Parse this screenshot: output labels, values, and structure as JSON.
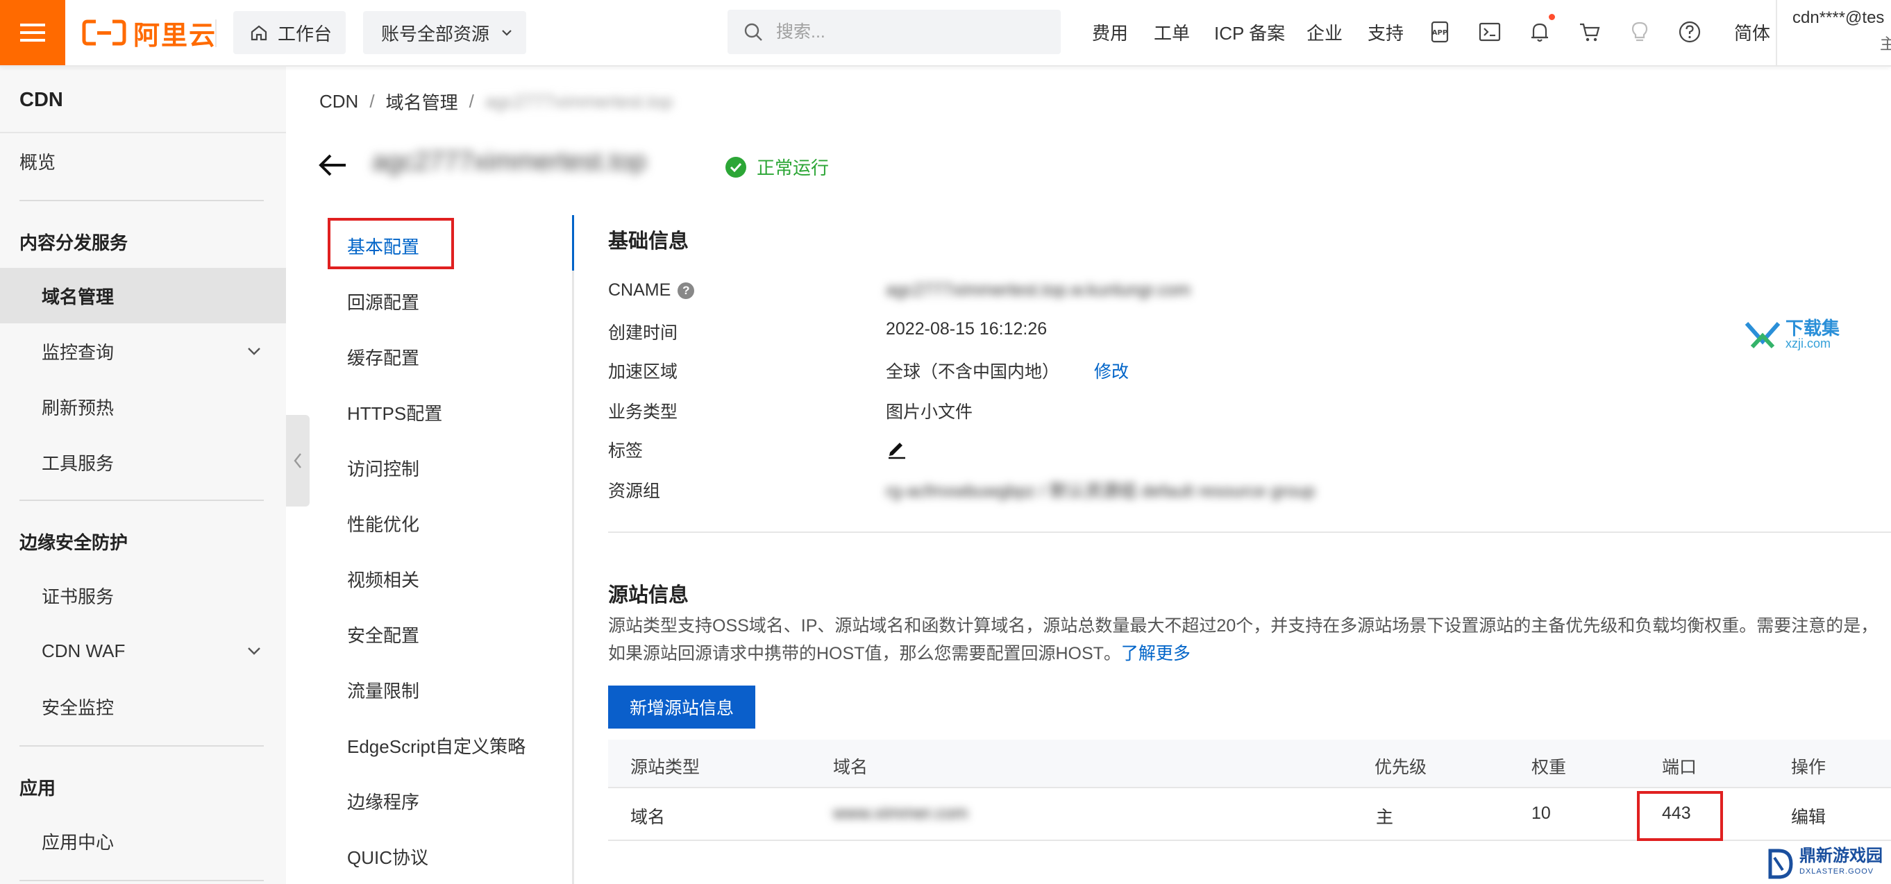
{
  "brand": {
    "logo_text": "阿里云",
    "accent": "#ff6a00"
  },
  "topbar": {
    "workbench": "工作台",
    "resource_scope": "账号全部资源",
    "search_placeholder": "搜索...",
    "nav": [
      "费用",
      "工单",
      "ICP 备案",
      "企业",
      "支持"
    ],
    "lang": "简体",
    "account": "cdn****@tes",
    "account_sub": "主"
  },
  "sidebar": {
    "title": "CDN",
    "overview": "概览",
    "group1": {
      "title": "内容分发服务",
      "items": [
        "域名管理",
        "监控查询",
        "刷新预热",
        "工具服务"
      ]
    },
    "group2": {
      "title": "边缘安全防护",
      "items": [
        "证书服务",
        "CDN WAF",
        "安全监控"
      ]
    },
    "group3": {
      "title": "应用",
      "items": [
        "应用中心"
      ]
    }
  },
  "breadcrumb": [
    "CDN",
    "域名管理",
    "agc2777ximmertest.top"
  ],
  "header": {
    "domain": "agc2777ximmertest.top",
    "status": "正常运行",
    "status_color": "#2ca636"
  },
  "config_nav": [
    "基本配置",
    "回源配置",
    "缓存配置",
    "HTTPS配置",
    "访问控制",
    "性能优化",
    "视频相关",
    "安全配置",
    "流量限制",
    "EdgeScript自定义策略",
    "边缘程序",
    "QUIC协议"
  ],
  "basic_info": {
    "title": "基础信息",
    "cname_label": "CNAME",
    "cname_value": "agc2777ximmertest.top.w.kunlungr.com",
    "created_label": "创建时间",
    "created_value": "2022-08-15 16:12:26",
    "region_label": "加速区域",
    "region_value": "全球（不含中国内地）",
    "region_edit": "修改",
    "biz_label": "业务类型",
    "biz_value": "图片小文件",
    "tag_label": "标签",
    "rg_label": "资源组",
    "rg_value": "rg-acfmxwbuwgbpz / 默认资源组 default resource group"
  },
  "origin_info": {
    "title": "源站信息",
    "desc": "源站类型支持OSS域名、IP、源站域名和函数计算域名，源站总数量最大不超过20个，并支持在多源站场景下设置源站的主备优先级和负载均衡权重。需要注意的是，如果源站回源请求中携带的HOST值，那么您需要配置回源HOST。",
    "learn_more": "了解更多",
    "add_button": "新增源站信息",
    "columns": [
      "源站类型",
      "域名",
      "优先级",
      "权重",
      "端口",
      "操作"
    ],
    "rows": [
      {
        "type": "域名",
        "domain": "www.ximmer.com",
        "priority": "主",
        "weight": "10",
        "port": "443",
        "action": "编辑"
      }
    ]
  },
  "watermarks": {
    "w1_cn": "下载集",
    "w1_en": "xzji.com",
    "w2_cn": "鼎新游戏园",
    "w2_en": "DXLASTER.GOOV"
  }
}
